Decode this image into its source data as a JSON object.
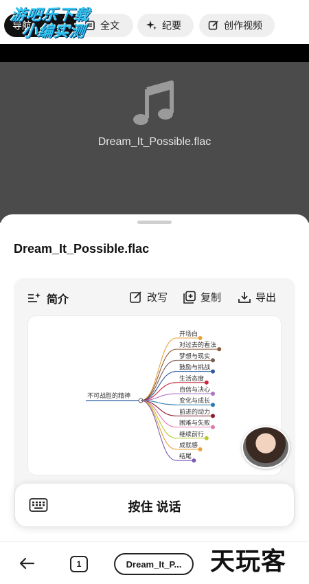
{
  "top_tabs": {
    "first_label": "导航",
    "quanwen": "全文",
    "jiyao": "纪要",
    "video": "创作视频"
  },
  "watermark": {
    "line1": "游吧乐下载",
    "line2": "小编实测"
  },
  "player": {
    "file_name": "Dream_It_Possible.flac"
  },
  "sheet": {
    "title": "Dream_It_Possible.flac",
    "summary_label": "简介",
    "actions": {
      "edit": "改写",
      "copy": "复制",
      "export": "导出"
    }
  },
  "mindmap": {
    "root": "不可战胜的精神",
    "branches": [
      {
        "label": "开场白",
        "color": "#e8a23a"
      },
      {
        "label": "对过去的看法",
        "color": "#8a5a3a"
      },
      {
        "label": "梦想与现实",
        "color": "#7a5a4a"
      },
      {
        "label": "鼓励与挑战",
        "color": "#2a5aa0"
      },
      {
        "label": "生活态度",
        "color": "#c8283a"
      },
      {
        "label": "自信与决心",
        "color": "#b070c8"
      },
      {
        "label": "变化与成长",
        "color": "#2a7ab0"
      },
      {
        "label": "前进的动力",
        "color": "#8a1a2a"
      },
      {
        "label": "困难与失败",
        "color": "#e07ab0"
      },
      {
        "label": "继续前行",
        "color": "#b8c82a"
      },
      {
        "label": "成就感",
        "color": "#e8a23a"
      },
      {
        "label": "结尾",
        "color": "#7a5ab0"
      }
    ]
  },
  "talk_bar": {
    "label": "按住 说话"
  },
  "navbar": {
    "tab_count": "1",
    "page_pill": "Dream_It_P...",
    "brand_mark": "天玩客"
  }
}
